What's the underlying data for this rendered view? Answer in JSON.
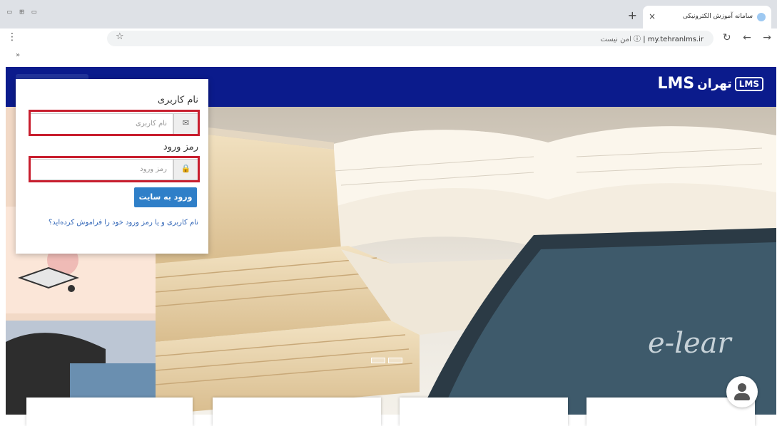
{
  "browser": {
    "tab_title": "سامانه آموزش الکترونیکی",
    "tab_close": "×",
    "new_tab": "+",
    "url": "my.tehranlms.ir",
    "security_label": "امن نیست",
    "window_controls": "▭ ⊞ ▭"
  },
  "site": {
    "logo_latin": "LMS",
    "logo_farsi": "تهران",
    "logo_badge": "LMS"
  },
  "login": {
    "username_label": "نام کاربری",
    "username_placeholder": "نام کاربری",
    "password_label": "رمز ورود",
    "password_placeholder": "رمز ورود",
    "submit_label": "ورود به سایت",
    "forgot_link": "نام کاربری و یا رمز ورود خود را فراموش کرده‌اید؟"
  },
  "hero": {
    "tablet_text": "e-lear"
  },
  "icons": {
    "envelope": "✉",
    "lock": "🔒"
  },
  "colors": {
    "header": "#0b1b8c",
    "highlight": "#c81e2e",
    "button": "#2f7fc8"
  }
}
